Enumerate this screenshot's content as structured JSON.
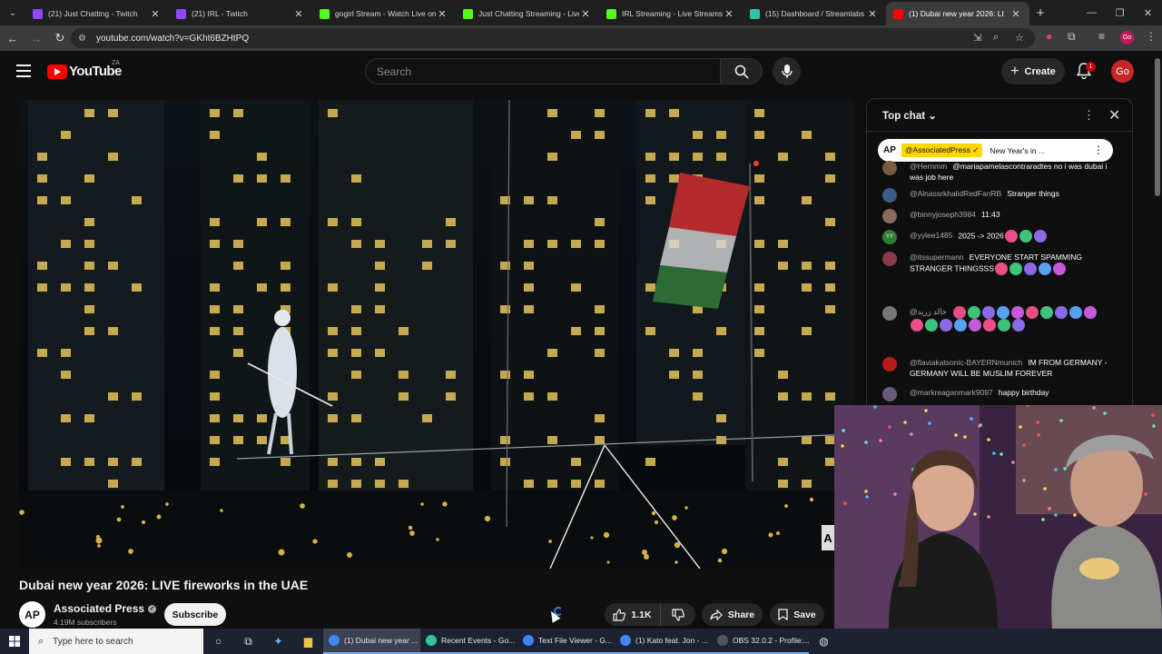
{
  "browser": {
    "tabs": [
      {
        "title": "(21) Just Chatting - Twitch",
        "favicon": "twitch-icon",
        "color": "#9146ff"
      },
      {
        "title": "(21) IRL - Twitch",
        "favicon": "twitch-icon",
        "color": "#9146ff"
      },
      {
        "title": "gogirl Stream - Watch Live on K",
        "favicon": "kick-icon",
        "color": "#53fc18"
      },
      {
        "title": "Just Chatting Streaming - Live S",
        "favicon": "kick-icon",
        "color": "#53fc18"
      },
      {
        "title": "IRL Streaming - Live Streams or",
        "favicon": "kick-icon",
        "color": "#53fc18"
      },
      {
        "title": "(15) Dashboard / Streamlabs",
        "favicon": "streamlabs-icon",
        "color": "#31c3a2"
      },
      {
        "title": "(1) Dubai new year 2026: LI",
        "favicon": "youtube-icon",
        "color": "#ff0000",
        "active": true
      }
    ],
    "url": "youtube.com/watch?v=GKht6BZHtPQ",
    "profile_initials": "Go"
  },
  "youtube": {
    "logo_text": "YouTube",
    "country_code": "ZA",
    "search_placeholder": "Search",
    "create_label": "Create",
    "notification_count": "1",
    "avatar_initials": "Go"
  },
  "video": {
    "title": "Dubai new year 2026: LIVE fireworks in the UAE",
    "channel": {
      "avatar_text": "AP",
      "name": "Associated Press",
      "subscribers": "4.19M subscribers"
    },
    "subscribe_label": "Subscribe",
    "like_count": "1.1K",
    "share_label": "Share",
    "save_label": "Save"
  },
  "chat": {
    "title": "Top chat",
    "pinned": {
      "avatar": "AP",
      "author": "@AssociatedPress",
      "text": "New Year's in ..."
    },
    "messages": [
      {
        "author": "@Hernmm",
        "text": "@mariapamelascontraradtes no i was dubai i was job here",
        "color": "#7a5c3c",
        "emotes": 0
      },
      {
        "author": "@AlnassrkhalidRedFanRB",
        "text": "Stranger things",
        "color": "#3b5b8a",
        "emotes": 0
      },
      {
        "author": "@binnyjoseph3984",
        "text": "11:43",
        "color": "#8a6a5a",
        "emotes": 0
      },
      {
        "author": "@yylee1485",
        "text": "2025 -> 2026",
        "color": "#2e7d32",
        "avatar": "YY",
        "emotes": 3
      },
      {
        "author": "@itssupermann",
        "text": "EVERYONE  START SPAMMING  STRANGER THINGSSS",
        "color": "#8a3a4a",
        "emotes": 5
      },
      {
        "author": "@خالد زرید",
        "text": "",
        "color": "#777777",
        "emotes": 18
      },
      {
        "author": "@flaviakatsonic-BAYERNmunich",
        "text": "IM FROM GERMANY - GERMANY WILL BE MUSLIM FOREVER",
        "color": "#b71c1c",
        "emotes": 0
      },
      {
        "author": "@markreaganmark9097",
        "text": "happy birthday",
        "color": "#6a5a7a",
        "emotes": 0
      }
    ]
  },
  "taskbar": {
    "search_placeholder": "Type here to search",
    "apps": [
      {
        "label": "(1) Dubai new year ...",
        "color": "#4285f4",
        "active": true
      },
      {
        "label": "Recent Events - Go...",
        "color": "#31c3a2"
      },
      {
        "label": "Text File Viewer - G...",
        "color": "#4285f4"
      },
      {
        "label": "(1) Kato feat. Jon - ...",
        "color": "#4285f4"
      },
      {
        "label": "OBS 32.0.2 - Profile:...",
        "color": "#555555"
      }
    ]
  }
}
